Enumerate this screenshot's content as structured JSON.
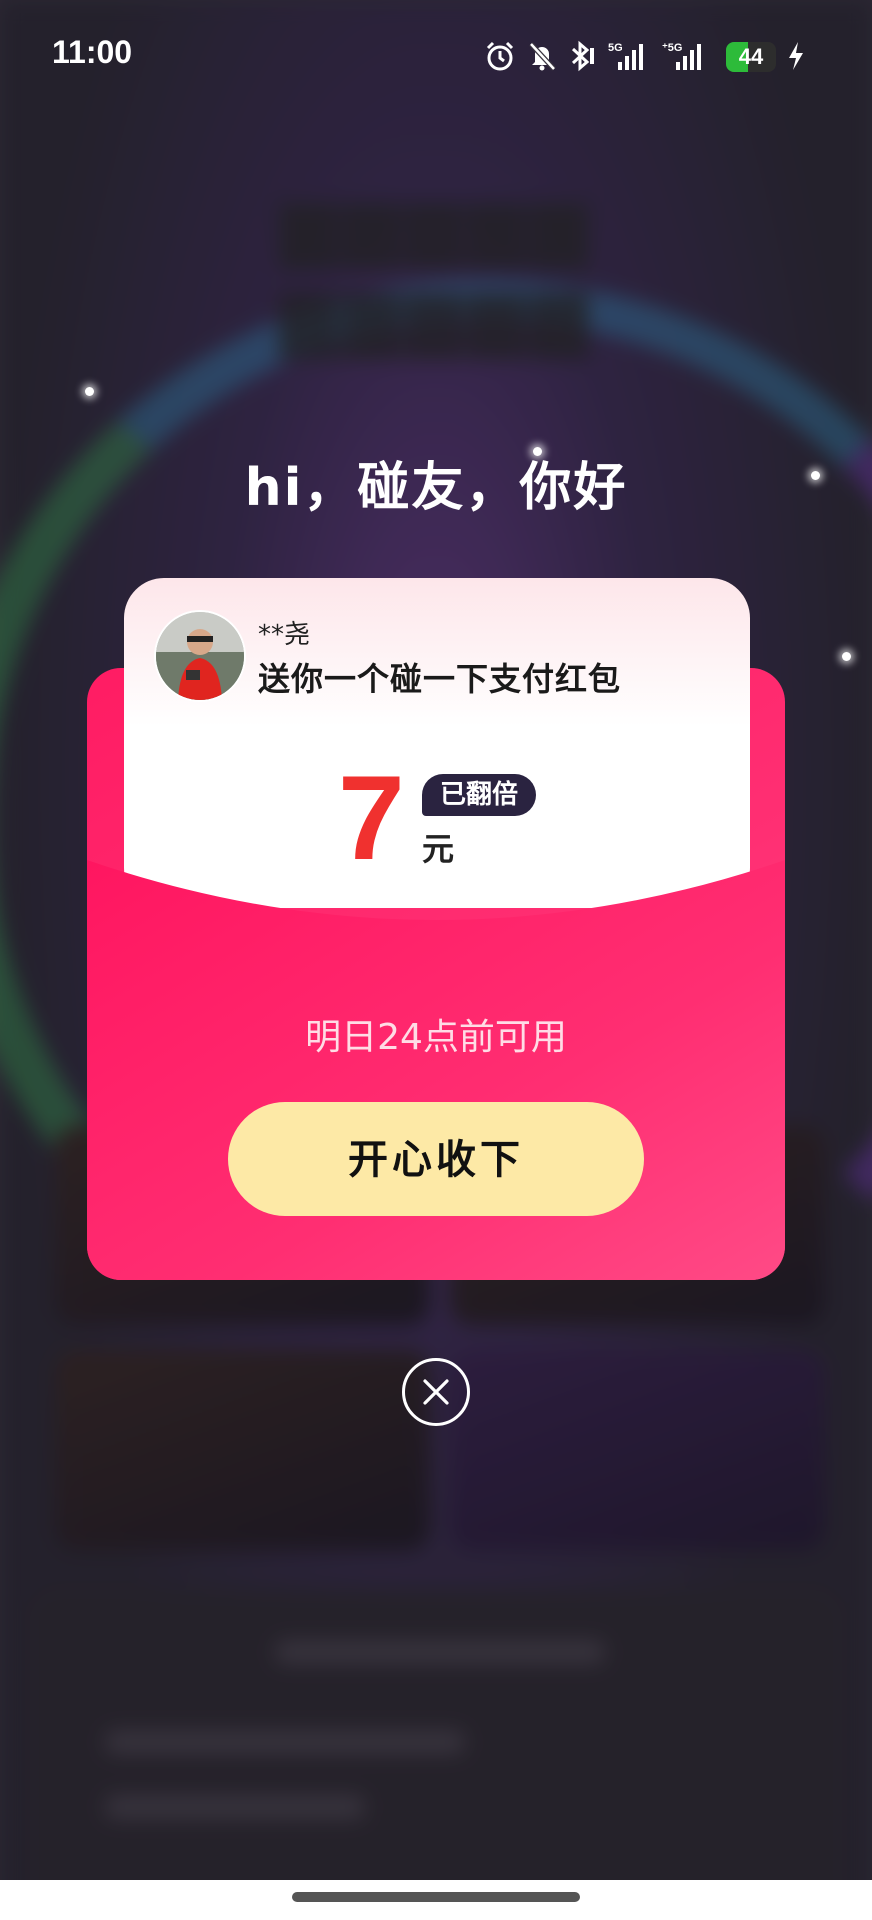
{
  "status_bar": {
    "time": "11:00",
    "battery_level": "44",
    "battery_fraction": 0.44,
    "network_1": "5G",
    "network_2": "5G",
    "icons": [
      "alarm-icon",
      "mute-bell-icon",
      "bluetooth-icon",
      "signal-5g-icon",
      "signal-5g-icon",
      "battery-icon",
      "charging-icon"
    ]
  },
  "popup": {
    "greeting": "hi，碰友，你好",
    "sender_name": "**尧",
    "message": "送你一个碰一下支付红包",
    "amount": "7",
    "amount_unit": "元",
    "doubled_badge": "已翻倍",
    "expiry_note": "明日24点前可用",
    "accept_button": "开心收下",
    "close_icon": "close-icon"
  },
  "colors": {
    "envelope_red": "#ff2f73",
    "amount_red": "#f0312f",
    "button_yellow": "#fde9a6",
    "badge_navy": "#2a2340"
  }
}
